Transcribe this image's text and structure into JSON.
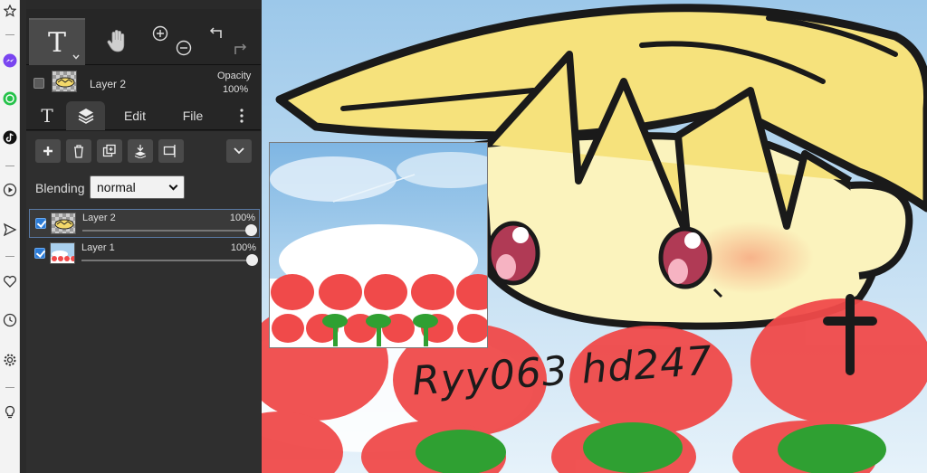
{
  "browser_sidebar": {
    "icons": [
      "star-icon",
      "messenger-icon",
      "whatsapp-icon",
      "tiktok-icon",
      "play-icon",
      "send-icon",
      "heart-icon",
      "clock-icon",
      "gear-icon",
      "lightbulb-icon"
    ]
  },
  "tools": {
    "text_tool_glyph": "T"
  },
  "layer_info": {
    "name": "Layer 2",
    "opacity_label": "Opacity",
    "opacity_value": "100%"
  },
  "tabs": {
    "text_glyph": "T",
    "edit": "Edit",
    "file": "File"
  },
  "blending": {
    "label": "Blending",
    "value": "normal"
  },
  "layers": [
    {
      "name": "Layer 2",
      "opacity": "100%",
      "visible": true,
      "selected": true
    },
    {
      "name": "Layer 1",
      "opacity": "100%",
      "visible": true,
      "selected": false
    }
  ],
  "canvas": {
    "signature": "Ryy063 hd247"
  },
  "colors": {
    "accent_blue": "#2b7bd6",
    "panel_bg": "#2f2f2f",
    "tulip_red": "#f04a4a",
    "leaf_green": "#2fa032",
    "hair_yellow": "#f6e27c"
  }
}
